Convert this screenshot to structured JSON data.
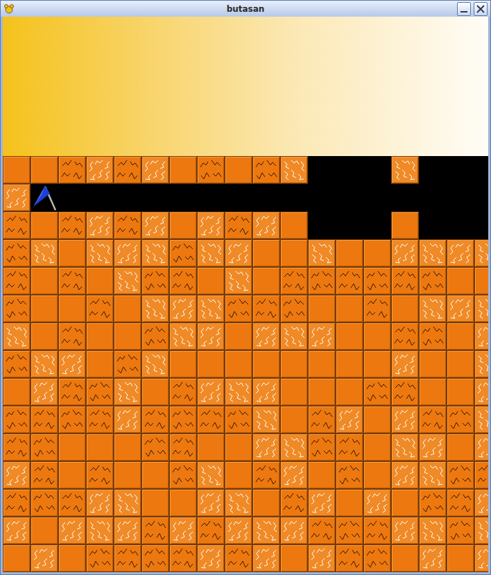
{
  "window": {
    "title": "butasan"
  },
  "board": {
    "rows": [
      "ppcwcwpcpcweeeweee",
      "wheeeeeeeeeeeeeeee",
      "cpcwcwpwcwpeeepeee",
      "cwpwwwcwwppwppwwww",
      "cpcpwccpwpccccccpp",
      "cppcpwwwcccppcpwww",
      "wpcppcwwpwwwppccpw",
      "cwwpcwppppppppwppw",
      "pwccwpcwwwpppccppw",
      "ccccwccccwpcwpwccw",
      "ccpppccppwwccpwwpw",
      "wcpcppcwpcwpcpwwcc",
      "cccwwppwwpcwpwpccw",
      "wpwwwcwcwwwcccwwcw",
      "pwpccccwcwpwccpwpw"
    ]
  }
}
